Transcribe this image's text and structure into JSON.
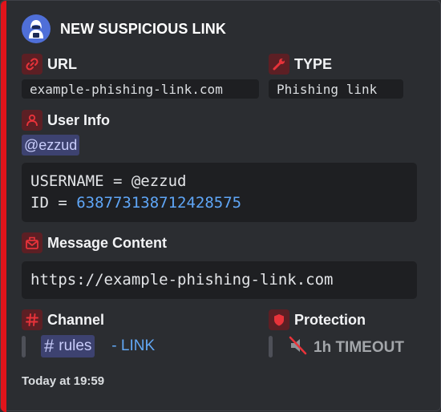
{
  "embed": {
    "author": "NEW SUSPICIOUS LINK",
    "avatar_icon": "hacker-avatar-icon",
    "accent_color": "#e0141b",
    "fields": {
      "url": {
        "name": "URL",
        "icon": "link-icon",
        "value": "example-phishing-link.com"
      },
      "type": {
        "name": "TYPE",
        "icon": "wrench-icon",
        "value": "Phishing link"
      },
      "user_info": {
        "name": "User Info",
        "icon": "user-icon",
        "mention": "@ezzud",
        "code_line1": "USERNAME = @ezzud",
        "code_id_label": "ID = ",
        "code_id_value": "638773138712428575"
      },
      "message_content": {
        "name": "Message Content",
        "icon": "envelope-icon",
        "value": "https://example-phishing-link.com"
      },
      "channel": {
        "name": "Channel",
        "icon": "hash-icon",
        "channel_name": "rules",
        "suffix": " - LINK"
      },
      "protection": {
        "name": "Protection",
        "icon": "shield-icon",
        "value": "1h TIMEOUT",
        "value_icon": "muted-speaker-icon"
      }
    },
    "footer": "Today at 19:59"
  }
}
